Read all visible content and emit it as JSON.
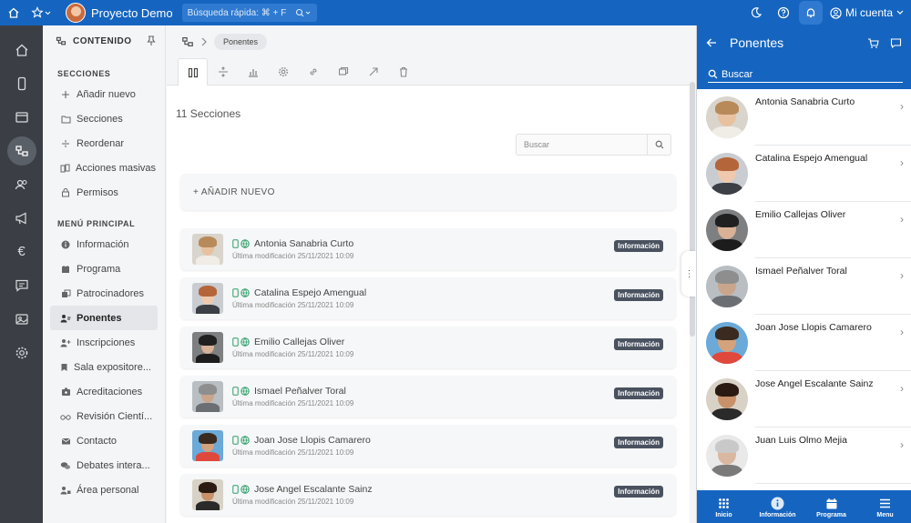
{
  "topbar": {
    "project_name": "Proyecto Demo",
    "quick_search": "Búsqueda rápida: ⌘ + F",
    "account_label": "Mi cuenta",
    "bg_color": "#1565c0"
  },
  "sidebar": {
    "header": "CONTENIDO",
    "sections_title": "SECCIONES",
    "section_items": [
      {
        "label": "Añadir nuevo",
        "icon": "plus-icon"
      },
      {
        "label": "Secciones",
        "icon": "folder-icon"
      },
      {
        "label": "Reordenar",
        "icon": "reorder-icon"
      },
      {
        "label": "Acciones masivas",
        "icon": "copy-icon"
      },
      {
        "label": "Permisos",
        "icon": "lock-icon"
      }
    ],
    "menu_title": "MENÚ PRINCIPAL",
    "menu_items": [
      {
        "label": "Información",
        "icon": "info-icon"
      },
      {
        "label": "Programa",
        "icon": "calendar-icon"
      },
      {
        "label": "Patrocinadores",
        "icon": "sponsors-icon"
      },
      {
        "label": "Ponentes",
        "icon": "speakers-icon"
      },
      {
        "label": "Inscripciones",
        "icon": "user-plus-icon"
      },
      {
        "label": "Sala expositore...",
        "icon": "bookmark-icon"
      },
      {
        "label": "Acreditaciones",
        "icon": "badge-icon"
      },
      {
        "label": "Revisión Cientí...",
        "icon": "glasses-icon"
      },
      {
        "label": "Contacto",
        "icon": "envelope-icon"
      },
      {
        "label": "Debates intera...",
        "icon": "chat-icon"
      },
      {
        "label": "Área personal",
        "icon": "user-lock-icon"
      }
    ]
  },
  "main": {
    "breadcrumb": "Ponentes",
    "count_label": "11 Secciones",
    "search_placeholder": "Buscar",
    "add_new_label": "+ AÑADIR NUEVO",
    "rows": [
      {
        "name": "Antonia Sanabria Curto",
        "modified": "Última modificación 25/11/2021 10:09",
        "badge": "Información"
      },
      {
        "name": "Catalina Espejo Amengual",
        "modified": "Última modificación 25/11/2021 10:09",
        "badge": "Información"
      },
      {
        "name": "Emilio Callejas Oliver",
        "modified": "Última modificación 25/11/2021 10:09",
        "badge": "Información"
      },
      {
        "name": "Ismael Peñalver Toral",
        "modified": "Última modificación 25/11/2021 10:09",
        "badge": "Información"
      },
      {
        "name": "Joan Jose Llopis Camarero",
        "modified": "Última modificación 25/11/2021 10:09",
        "badge": "Información"
      },
      {
        "name": "Jose Angel Escalante Sainz",
        "modified": "Última modificación 25/11/2021 10:09",
        "badge": "Información"
      }
    ]
  },
  "panel": {
    "title": "Ponentes",
    "search_placeholder": "Buscar",
    "items": [
      "Antonia Sanabria Curto",
      "Catalina Espejo Amengual",
      "Emilio Callejas Oliver",
      "Ismael Peñalver Toral",
      "Joan Jose Llopis Camarero",
      "Jose Angel Escalante Sainz",
      "Juan Luis Olmo Mejia"
    ],
    "tabs": [
      "Inicio",
      "Información",
      "Programa",
      "Menu"
    ]
  }
}
